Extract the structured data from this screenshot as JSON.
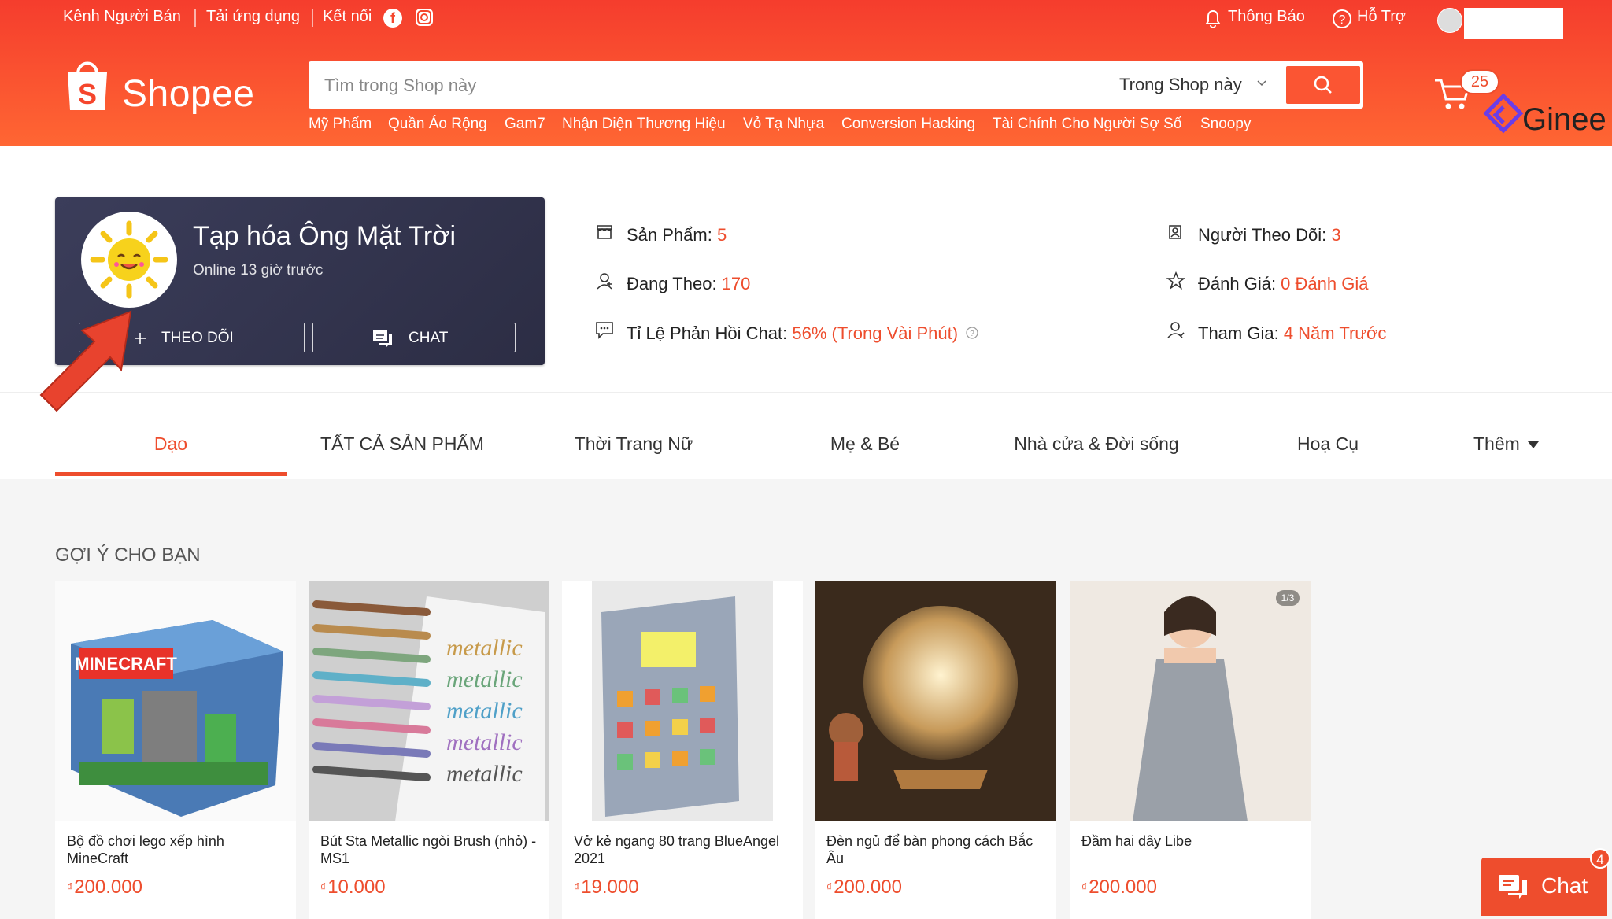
{
  "topbar": {
    "seller_channel": "Kênh Người Bán",
    "download_app": "Tải ứng dụng",
    "connect": "Kết nối",
    "notifications": "Thông Báo",
    "help": "Hỗ Trợ"
  },
  "logo": {
    "text": "Shopee"
  },
  "search": {
    "placeholder": "Tìm trong Shop này",
    "scope": "Trong Shop này"
  },
  "hotwords": [
    "Mỹ Phẩm",
    "Quần Áo Rộng",
    "Gam7",
    "Nhận Diện Thương Hiệu",
    "Vỏ Tạ Nhựa",
    "Conversion Hacking",
    "Tài Chính Cho Người Sợ Số",
    "Snoopy"
  ],
  "cart": {
    "count": "25"
  },
  "watermark": {
    "text": "Ginee"
  },
  "shop": {
    "name": "Tạp hóa Ông Mặt Trời",
    "status": "Online 13 giờ trước",
    "follow_label": "THEO DÕI",
    "chat_label": "CHAT"
  },
  "stats": {
    "products_label": "Sản Phẩm: ",
    "products_value": "5",
    "following_label": "Đang Theo: ",
    "following_value": "170",
    "response_label": "Tỉ Lệ Phản Hồi Chat: ",
    "response_value": "56% (Trong Vài Phút)",
    "followers_label": "Người Theo Dõi: ",
    "followers_value": "3",
    "rating_label": "Đánh Giá: ",
    "rating_value": "0 Đánh Giá",
    "joined_label": "Tham Gia: ",
    "joined_value": "4 Năm Trước"
  },
  "tabs": [
    "Dạo",
    "TẤT CẢ SẢN PHẨM",
    "Thời Trang Nữ",
    "Mẹ & Bé",
    "Nhà cửa & Đời sống",
    "Hoạ Cụ"
  ],
  "more_label": "Thêm",
  "section_title": "GỢI Ý CHO BẠN",
  "currency": "₫",
  "products": [
    {
      "name": "Bộ đồ chơi lego xếp hình MineCraft",
      "price": "200.000"
    },
    {
      "name": "Bút Sta Metallic ngòi Brush (nhỏ) - MS1",
      "price": "10.000"
    },
    {
      "name": "Vở kẻ ngang 80 trang BlueAngel 2021",
      "price": "19.000"
    },
    {
      "name": "Đèn ngủ để bàn phong cách Bắc Âu",
      "price": "200.000"
    },
    {
      "name": "Đầm hai dây Libe",
      "price": "200.000"
    }
  ],
  "image_badge": "1/3",
  "chat_widget": {
    "label": "Chat",
    "badge": "4"
  },
  "colors": {
    "brand": "#ee4d2d",
    "card_bg": "#2c2d44"
  }
}
